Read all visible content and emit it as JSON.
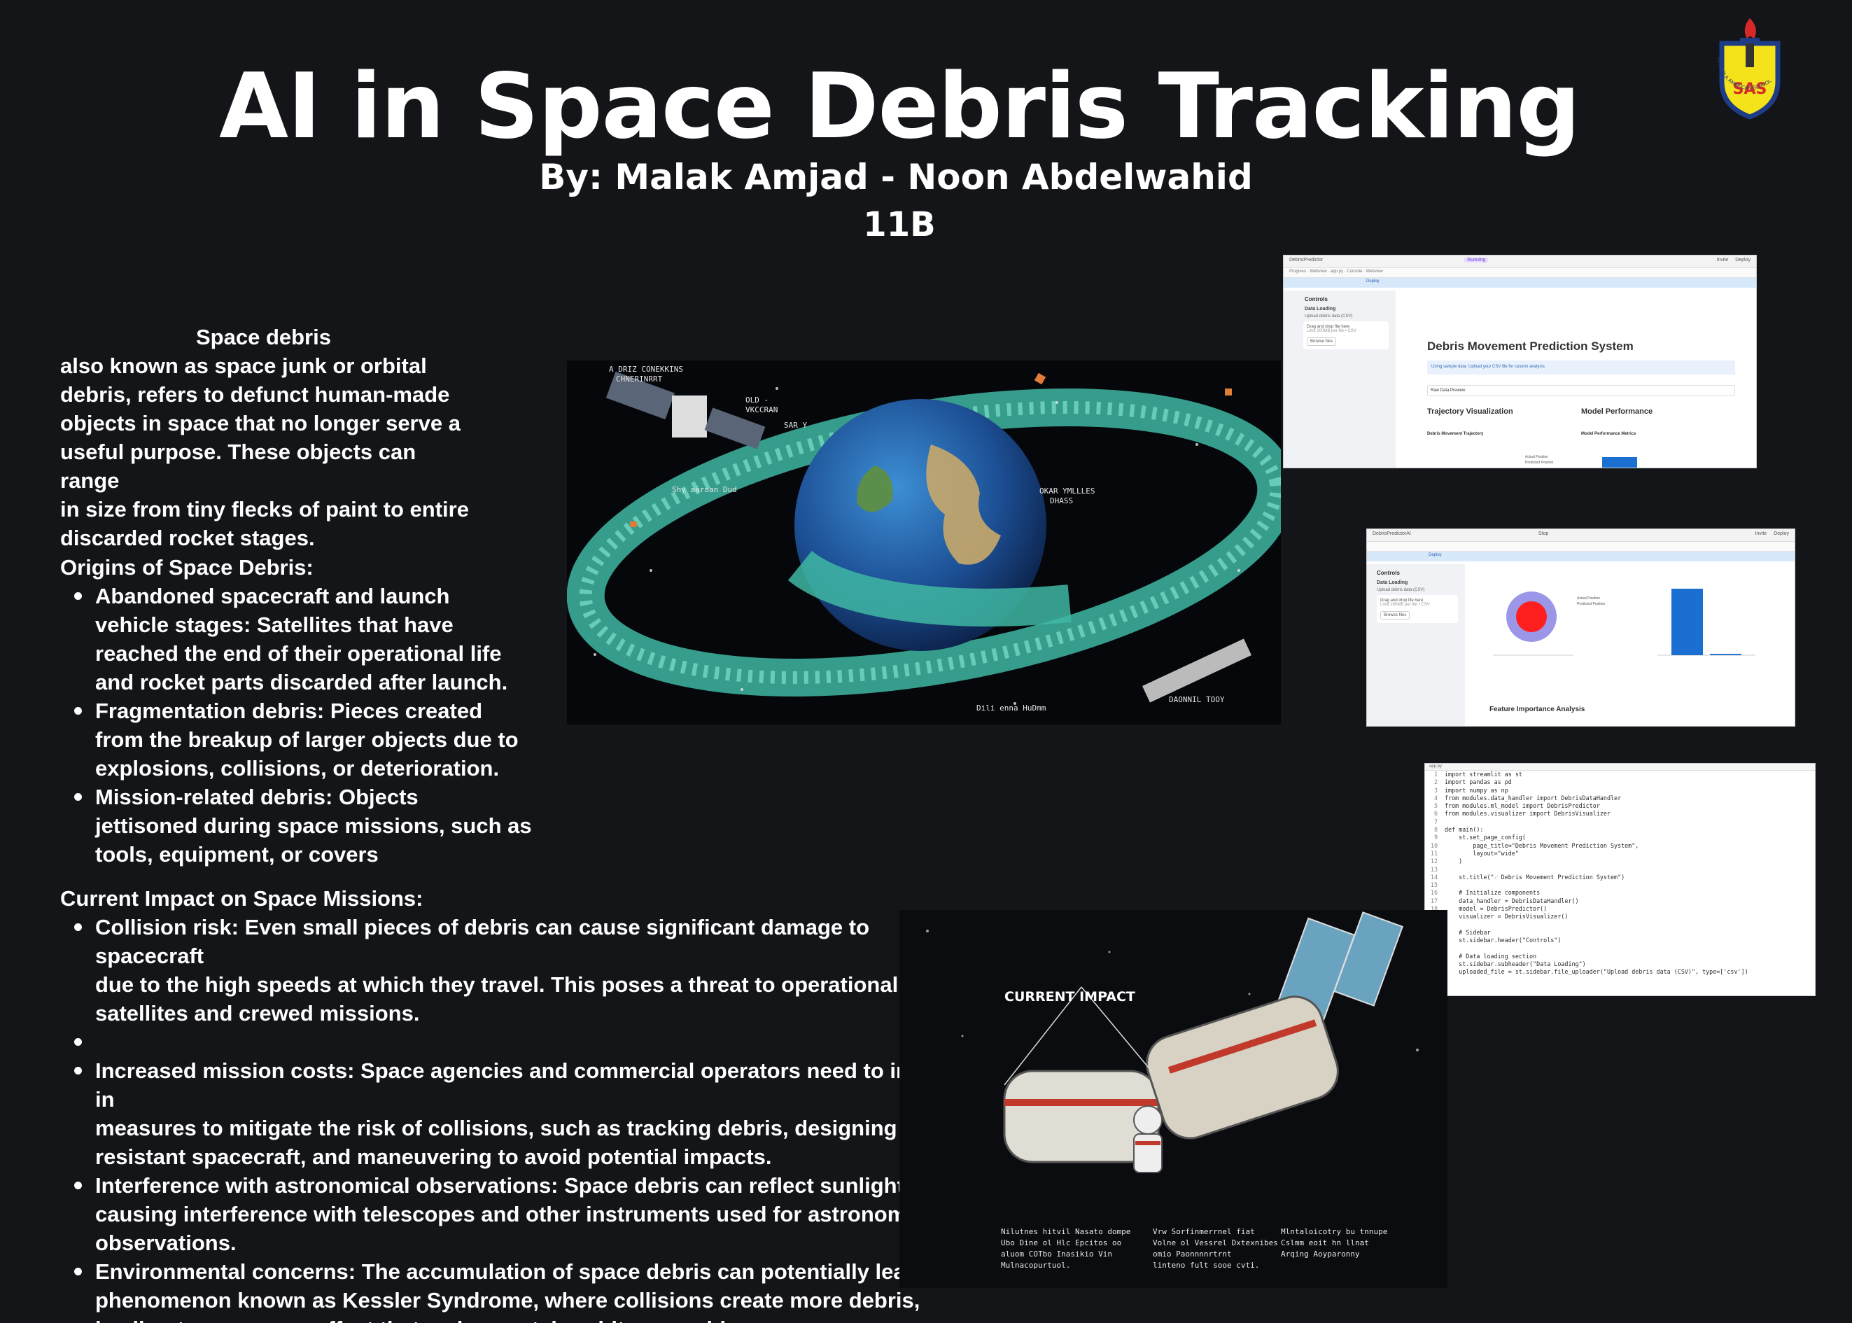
{
  "header": {
    "title": "AI in Space Debris Tracking",
    "authors": "By: Malak Amjad - Noon Abdelwahid",
    "class": "11B"
  },
  "logo": {
    "name": "school-crest-logo",
    "letters": "SAS",
    "ring_text": "AL SHOLA AMERICAN SCHOOL",
    "colors": {
      "shield": "#f4e21a",
      "border": "#1f3d86",
      "flame": "#d62828"
    }
  },
  "intro": {
    "heading": "Space debris",
    "lines": [
      "also known as space junk or orbital",
      "debris, refers to defunct human-made",
      "objects in space that no longer serve a",
      "useful purpose. These objects can range",
      "in size from tiny flecks of paint to entire",
      "discarded rocket stages."
    ]
  },
  "origins": {
    "heading": "Origins of Space Debris:",
    "items": [
      [
        "Abandoned spacecraft and launch",
        "vehicle stages: Satellites that have",
        "reached the end of their operational life",
        "and rocket parts discarded after launch."
      ],
      [
        "Fragmentation debris: Pieces created",
        "from the breakup of larger objects due to",
        "explosions, collisions, or deterioration."
      ],
      [
        "Mission-related debris: Objects",
        "jettisoned during space missions, such as",
        "tools, equipment, or covers"
      ]
    ]
  },
  "impact": {
    "heading": "Current Impact on Space Missions:",
    "items": [
      [
        "Collision risk: Even small pieces of debris can cause significant damage to spacecraft",
        "due to the high speeds at which they travel. This poses a threat to operational",
        "satellites and crewed missions."
      ],
      [
        ""
      ],
      [
        "Increased mission costs: Space agencies and commercial operators need to invest in",
        "measures to mitigate the risk of collisions, such as tracking debris, designing more",
        "resistant spacecraft, and maneuvering to avoid potential impacts."
      ],
      [
        "Interference with astronomical observations: Space debris can reflect sunlight,",
        "causing interference with telescopes and other instruments used for astronomical",
        "observations."
      ],
      [
        "Environmental concerns: The accumulation of space debris can potentially lead to a",
        "phenomenon known as Kessler Syndrome, where collisions create more debris,",
        "leading to a runaway effect that makes certain orbits unusable."
      ]
    ]
  },
  "earth_image": {
    "labels": [
      "A DRIZ CONEKKINS",
      "CHNERINRRT",
      "OLD -",
      "VKCCRAN",
      "SAR Y",
      "Shy aāroan Dud",
      "OKAR YMLLLES",
      "DHASS",
      "DAONNIL TOOY",
      "Dili enna HuDmm"
    ]
  },
  "app_shot_1": {
    "tab": "DebrisPredictor",
    "status": "Running",
    "actions": [
      "Invite",
      "Deploy"
    ],
    "nav": [
      "Progress",
      "Webview",
      "app.py",
      "Console",
      "Webview"
    ],
    "banner": "Deploy",
    "sidebar": {
      "heading": "Controls",
      "section": "Data Loading",
      "upload_label": "Upload debris data (CSV)",
      "dropzone": "Drag and drop file here",
      "limit": "Limit 200MB per file • CSV",
      "button": "Browse files"
    },
    "main": {
      "title": "Debris Movement Prediction System",
      "info": "Using sample data. Upload your CSV file for custom analysis.",
      "select": "Raw Data Preview",
      "col1": "Trajectory Visualization",
      "col2": "Model Performance",
      "sub1": "Debris Movement Trajectory",
      "sub2": "Model Performance Metrics",
      "legend": [
        "Actual Position",
        "Predicted Position"
      ]
    }
  },
  "app_shot_2": {
    "tab": "DebrisPredictorAI",
    "status": "Stop",
    "actions": [
      "Invite",
      "Deploy"
    ],
    "banner": "Deploy",
    "sidebar": {
      "heading": "Controls",
      "section": "Data Loading",
      "upload_label": "Upload debris data (CSV)",
      "dropzone": "Drag and drop file here",
      "limit": "Limit 200MB per file • CSV",
      "button": "Browse files"
    },
    "main": {
      "section": "Feature Importance Analysis",
      "legend": [
        "Actual Position",
        "Predicted Position"
      ]
    },
    "bar_values": [
      1.0,
      0.02
    ]
  },
  "code_shot": {
    "path": "app.py",
    "lines": [
      "import streamlit as st",
      "import pandas as pd",
      "import numpy as np",
      "from modules.data_handler import DebrisDataHandler",
      "from modules.ml_model import DebrisPredictor",
      "from modules.visualizer import DebrisVisualizer",
      "",
      "def main():",
      "    st.set_page_config(",
      "        page_title=\"Debris Movement Prediction System\",",
      "        layout=\"wide\"",
      "    )",
      "",
      "    st.title(\"☄ Debris Movement Prediction System\")",
      "",
      "    # Initialize components",
      "    data_handler = DebrisDataHandler()",
      "    model = DebrisPredictor()",
      "    visualizer = DebrisVisualizer()",
      "",
      "    # Sidebar",
      "    st.sidebar.header(\"Controls\")",
      "",
      "    # Data loading section",
      "    st.sidebar.subheader(\"Data Loading\")",
      "    uploaded_file = st.sidebar.file_uploader(\"Upload debris data (CSV)\", type=['csv'])"
    ]
  },
  "impact_image": {
    "label": "CURRENT IMPACT",
    "captions": [
      [
        "Nilutnes hitvil Nasato dompe",
        "Ubo Dine ol Hlc Epcitos oo",
        "aluom COTbo Inasikio Vin",
        "Mulnacopurtuol."
      ],
      [
        "Vrw Sorfinmerrnel fiat",
        "Volne ol Vessrel Dxtexnibes",
        "omio Paonnnnrtrnt",
        "linteno fult sooe cvti."
      ],
      [
        "Mlntaloicotry bu tnnupe",
        "Cslmm eoit hn llnat",
        "Arqing Aoyparonny"
      ]
    ]
  }
}
